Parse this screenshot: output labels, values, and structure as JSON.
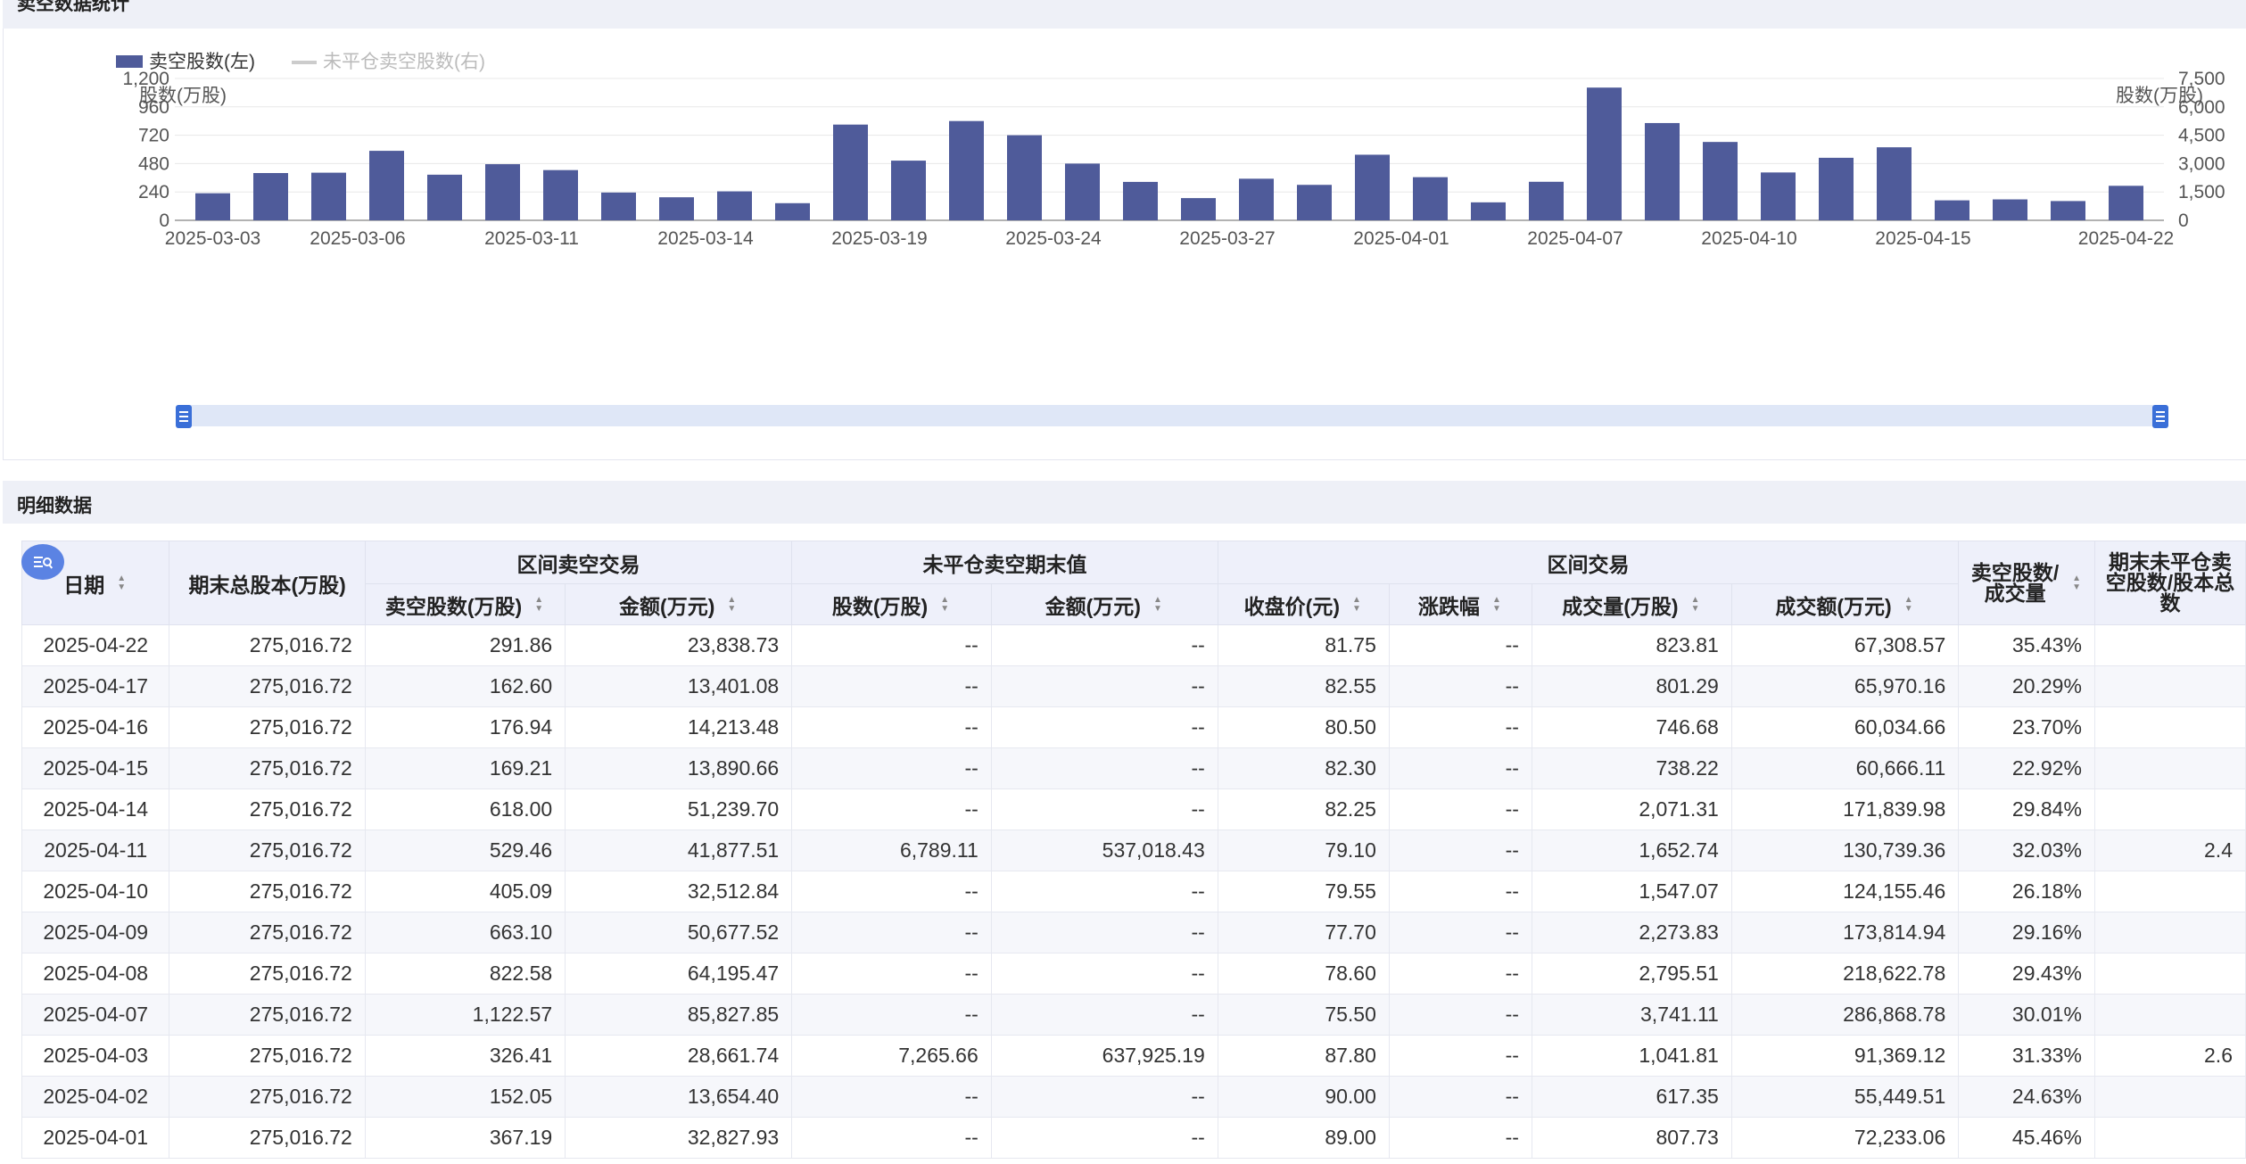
{
  "sections": {
    "chart_title": "卖空数据统计",
    "detail_title": "明细数据"
  },
  "colors": {
    "bar": "#4f5b9a",
    "legend_inactive": "#cccccc",
    "slider_track": "#dfe7f7",
    "slider_handle": "#3a6fd8",
    "header_bg": "#eef0fa"
  },
  "chart_data": {
    "type": "bar",
    "legend": [
      {
        "name": "卖空股数(左)",
        "active": true,
        "marker": "bar"
      },
      {
        "name": "未平仓卖空股数(右)",
        "active": false,
        "marker": "line"
      }
    ],
    "left_axis": {
      "title": "股数(万股)",
      "ticks": [
        "1,200",
        "960",
        "720",
        "480",
        "240",
        "0"
      ],
      "ylim": [
        0,
        1200
      ]
    },
    "right_axis": {
      "title": "股数(万股)",
      "ticks": [
        "7,500",
        "6,000",
        "4,500",
        "3,000",
        "1,500",
        "0"
      ],
      "ylim": [
        0,
        7500
      ]
    },
    "x_ticks": [
      "2025-03-03",
      "2025-03-06",
      "2025-03-11",
      "2025-03-14",
      "2025-03-19",
      "2025-03-24",
      "2025-03-27",
      "2025-04-01",
      "2025-04-07",
      "2025-04-10",
      "2025-04-15",
      "2025-04-22"
    ],
    "x_tick_every": 3,
    "grid": true,
    "series": [
      {
        "name": "卖空股数(左)",
        "values": [
          229,
          400,
          403,
          588,
          386,
          475,
          425,
          235,
          195,
          245,
          145,
          810,
          505,
          840,
          720,
          480,
          325,
          188,
          352,
          300,
          555,
          365,
          152,
          326,
          1123,
          823,
          663,
          405,
          529,
          618,
          169,
          177,
          163,
          292
        ]
      }
    ]
  },
  "table": {
    "header_groups": [
      {
        "label": "日期",
        "sortable": true
      },
      {
        "label": "期末总股本(万股)",
        "sortable": false
      },
      {
        "label": "区间卖空交易"
      },
      {
        "label": "未平仓卖空期末值"
      },
      {
        "label": "区间交易"
      },
      {
        "label": "卖空股数/成交量",
        "sortable": true
      },
      {
        "label": "期末未平仓卖空股数/股本总数"
      }
    ],
    "sub_headers": [
      "卖空股数(万股)",
      "金额(万元)",
      "股数(万股)",
      "金额(万元)",
      "收盘价(元)",
      "涨跌幅",
      "成交量(万股)",
      "成交额(万元)"
    ],
    "rows": [
      [
        "2025-04-22",
        "275,016.72",
        "291.86",
        "23,838.73",
        "--",
        "--",
        "81.75",
        "--",
        "823.81",
        "67,308.57",
        "35.43%",
        ""
      ],
      [
        "2025-04-17",
        "275,016.72",
        "162.60",
        "13,401.08",
        "--",
        "--",
        "82.55",
        "--",
        "801.29",
        "65,970.16",
        "20.29%",
        ""
      ],
      [
        "2025-04-16",
        "275,016.72",
        "176.94",
        "14,213.48",
        "--",
        "--",
        "80.50",
        "--",
        "746.68",
        "60,034.66",
        "23.70%",
        ""
      ],
      [
        "2025-04-15",
        "275,016.72",
        "169.21",
        "13,890.66",
        "--",
        "--",
        "82.30",
        "--",
        "738.22",
        "60,666.11",
        "22.92%",
        ""
      ],
      [
        "2025-04-14",
        "275,016.72",
        "618.00",
        "51,239.70",
        "--",
        "--",
        "82.25",
        "--",
        "2,071.31",
        "171,839.98",
        "29.84%",
        ""
      ],
      [
        "2025-04-11",
        "275,016.72",
        "529.46",
        "41,877.51",
        "6,789.11",
        "537,018.43",
        "79.10",
        "--",
        "1,652.74",
        "130,739.36",
        "32.03%",
        "2.4"
      ],
      [
        "2025-04-10",
        "275,016.72",
        "405.09",
        "32,512.84",
        "--",
        "--",
        "79.55",
        "--",
        "1,547.07",
        "124,155.46",
        "26.18%",
        ""
      ],
      [
        "2025-04-09",
        "275,016.72",
        "663.10",
        "50,677.52",
        "--",
        "--",
        "77.70",
        "--",
        "2,273.83",
        "173,814.94",
        "29.16%",
        ""
      ],
      [
        "2025-04-08",
        "275,016.72",
        "822.58",
        "64,195.47",
        "--",
        "--",
        "78.60",
        "--",
        "2,795.51",
        "218,622.78",
        "29.43%",
        ""
      ],
      [
        "2025-04-07",
        "275,016.72",
        "1,122.57",
        "85,827.85",
        "--",
        "--",
        "75.50",
        "--",
        "3,741.11",
        "286,868.78",
        "30.01%",
        ""
      ],
      [
        "2025-04-03",
        "275,016.72",
        "326.41",
        "28,661.74",
        "7,265.66",
        "637,925.19",
        "87.80",
        "--",
        "1,041.81",
        "91,369.12",
        "31.33%",
        "2.6"
      ],
      [
        "2025-04-02",
        "275,016.72",
        "152.05",
        "13,654.40",
        "--",
        "--",
        "90.00",
        "--",
        "617.35",
        "55,449.51",
        "24.63%",
        ""
      ],
      [
        "2025-04-01",
        "275,016.72",
        "367.19",
        "32,827.93",
        "--",
        "--",
        "89.00",
        "--",
        "807.73",
        "72,233.06",
        "45.46%",
        ""
      ]
    ]
  }
}
